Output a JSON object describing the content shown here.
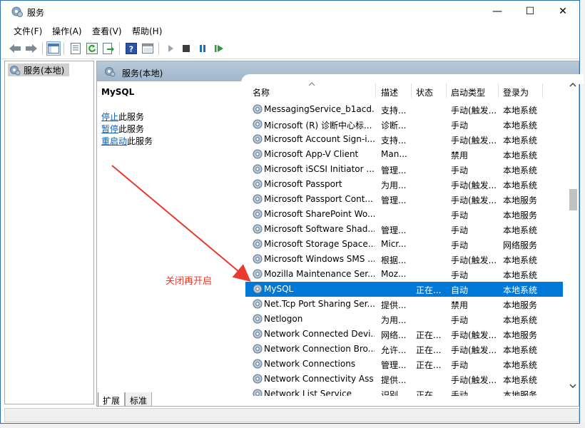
{
  "window": {
    "title": "服务"
  },
  "window_controls": {
    "minimize": "—",
    "maximize": "☐",
    "close": "✕"
  },
  "menu": [
    "文件(F)",
    "操作(A)",
    "查看(V)",
    "帮助(H)"
  ],
  "tree": {
    "item": "服务(本地)"
  },
  "pane": {
    "header": "服务(本地)",
    "service_name": "MySQL",
    "actions": [
      {
        "link": "停止",
        "suffix": "此服务"
      },
      {
        "link": "暂停",
        "suffix": "此服务"
      },
      {
        "link": "重启动",
        "suffix": "此服务"
      }
    ]
  },
  "columns": [
    "名称",
    "描述",
    "状态",
    "启动类型",
    "登录为"
  ],
  "rows": [
    {
      "name": "MessagingService_b1acd...",
      "desc": "支持...",
      "status": "",
      "startup": "手动(触发...",
      "logon": "本地系统"
    },
    {
      "name": "Microsoft (R) 诊断中心标...",
      "desc": "诊断...",
      "status": "",
      "startup": "手动",
      "logon": "本地系统"
    },
    {
      "name": "Microsoft Account Sign-i...",
      "desc": "支持...",
      "status": "",
      "startup": "手动(触发...",
      "logon": "本地系统"
    },
    {
      "name": "Microsoft App-V Client",
      "desc": "Man...",
      "status": "",
      "startup": "禁用",
      "logon": "本地系统"
    },
    {
      "name": "Microsoft iSCSI Initiator ...",
      "desc": "管理...",
      "status": "",
      "startup": "手动",
      "logon": "本地系统"
    },
    {
      "name": "Microsoft Passport",
      "desc": "为用...",
      "status": "",
      "startup": "手动(触发...",
      "logon": "本地系统"
    },
    {
      "name": "Microsoft Passport Cont...",
      "desc": "管理...",
      "status": "",
      "startup": "手动(触发...",
      "logon": "本地服务"
    },
    {
      "name": "Microsoft SharePoint Wo...",
      "desc": "",
      "status": "",
      "startup": "手动",
      "logon": "本地服务"
    },
    {
      "name": "Microsoft Software Shad...",
      "desc": "管理...",
      "status": "",
      "startup": "手动",
      "logon": "本地系统"
    },
    {
      "name": "Microsoft Storage Space...",
      "desc": "Micr...",
      "status": "",
      "startup": "手动",
      "logon": "网络服务"
    },
    {
      "name": "Microsoft Windows SMS ...",
      "desc": "根据...",
      "status": "",
      "startup": "手动(触发...",
      "logon": "本地系统"
    },
    {
      "name": "Mozilla Maintenance Ser...",
      "desc": "Moz...",
      "status": "",
      "startup": "手动",
      "logon": "本地系统"
    },
    {
      "name": "MySQL",
      "desc": "",
      "status": "正在...",
      "startup": "自动",
      "logon": "本地系统",
      "selected": true
    },
    {
      "name": "Net.Tcp Port Sharing Ser...",
      "desc": "提供...",
      "status": "",
      "startup": "禁用",
      "logon": "本地服务"
    },
    {
      "name": "Netlogon",
      "desc": "为用...",
      "status": "",
      "startup": "手动",
      "logon": "本地系统"
    },
    {
      "name": "Network Connected Devi...",
      "desc": "网络...",
      "status": "正在...",
      "startup": "手动(触发...",
      "logon": "本地服务"
    },
    {
      "name": "Network Connection Bro...",
      "desc": "允许...",
      "status": "正在...",
      "startup": "手动(触发...",
      "logon": "本地系统"
    },
    {
      "name": "Network Connections",
      "desc": "管理...",
      "status": "正在...",
      "startup": "手动",
      "logon": "本地系统"
    },
    {
      "name": "Network Connectivity Ass...",
      "desc": "提供...",
      "status": "",
      "startup": "手动(触发...",
      "logon": "本地系统"
    },
    {
      "name": "Network List Service",
      "desc": "识别...",
      "status": "正在...",
      "startup": "手动",
      "logon": "本地服务"
    }
  ],
  "tabs": [
    "扩展",
    "标准"
  ],
  "annotation": {
    "text": "关闭再开启",
    "color": "#e83a2e"
  },
  "colors": {
    "selection": "#0078d7",
    "link": "#0b5fb8",
    "header_band": "#b9c9d9"
  }
}
